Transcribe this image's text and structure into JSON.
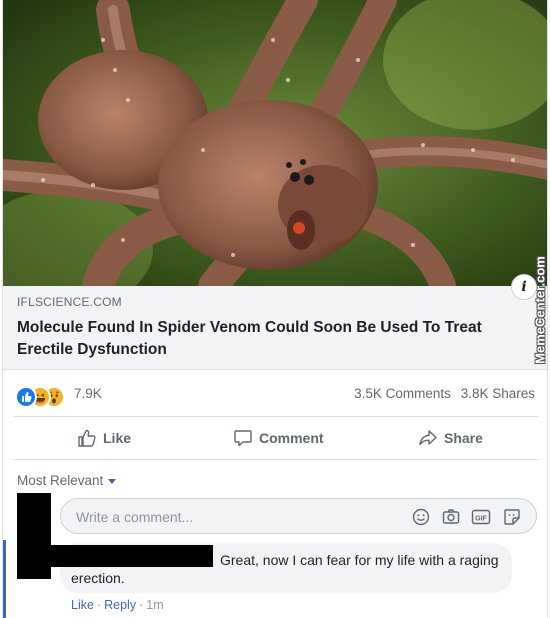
{
  "watermark": "MemeCenter.com",
  "link_preview": {
    "domain": "IFLSCIENCE.COM",
    "headline": "Molecule Found In Spider Venom Could Soon Be Used To Treat Erectile Dysfunction",
    "info_icon": "i"
  },
  "reactions": {
    "icons": [
      "like-icon",
      "haha-icon",
      "wow-icon"
    ],
    "colors": {
      "like": "#1877f2",
      "haha": "#f7b125",
      "wow": "#f7b125"
    },
    "count": "7.9K",
    "comments": "3.5K Comments",
    "shares": "3.8K Shares"
  },
  "actions": {
    "like": "Like",
    "comment": "Comment",
    "share": "Share"
  },
  "comments_section": {
    "sort_label": "Most Relevant",
    "input_placeholder": "Write a comment...",
    "input_icons": [
      "emoji-icon",
      "camera-icon",
      "gif-icon",
      "sticker-icon"
    ],
    "gif_label": "GIF"
  },
  "comment": {
    "text": "Great, now I can fear for my life with a raging erection.",
    "like": "Like",
    "reply": "Reply",
    "time": "1m"
  },
  "colors": {
    "accent": "#4267b2",
    "muted": "#606770",
    "link_box_bg": "#f2f3f5"
  }
}
